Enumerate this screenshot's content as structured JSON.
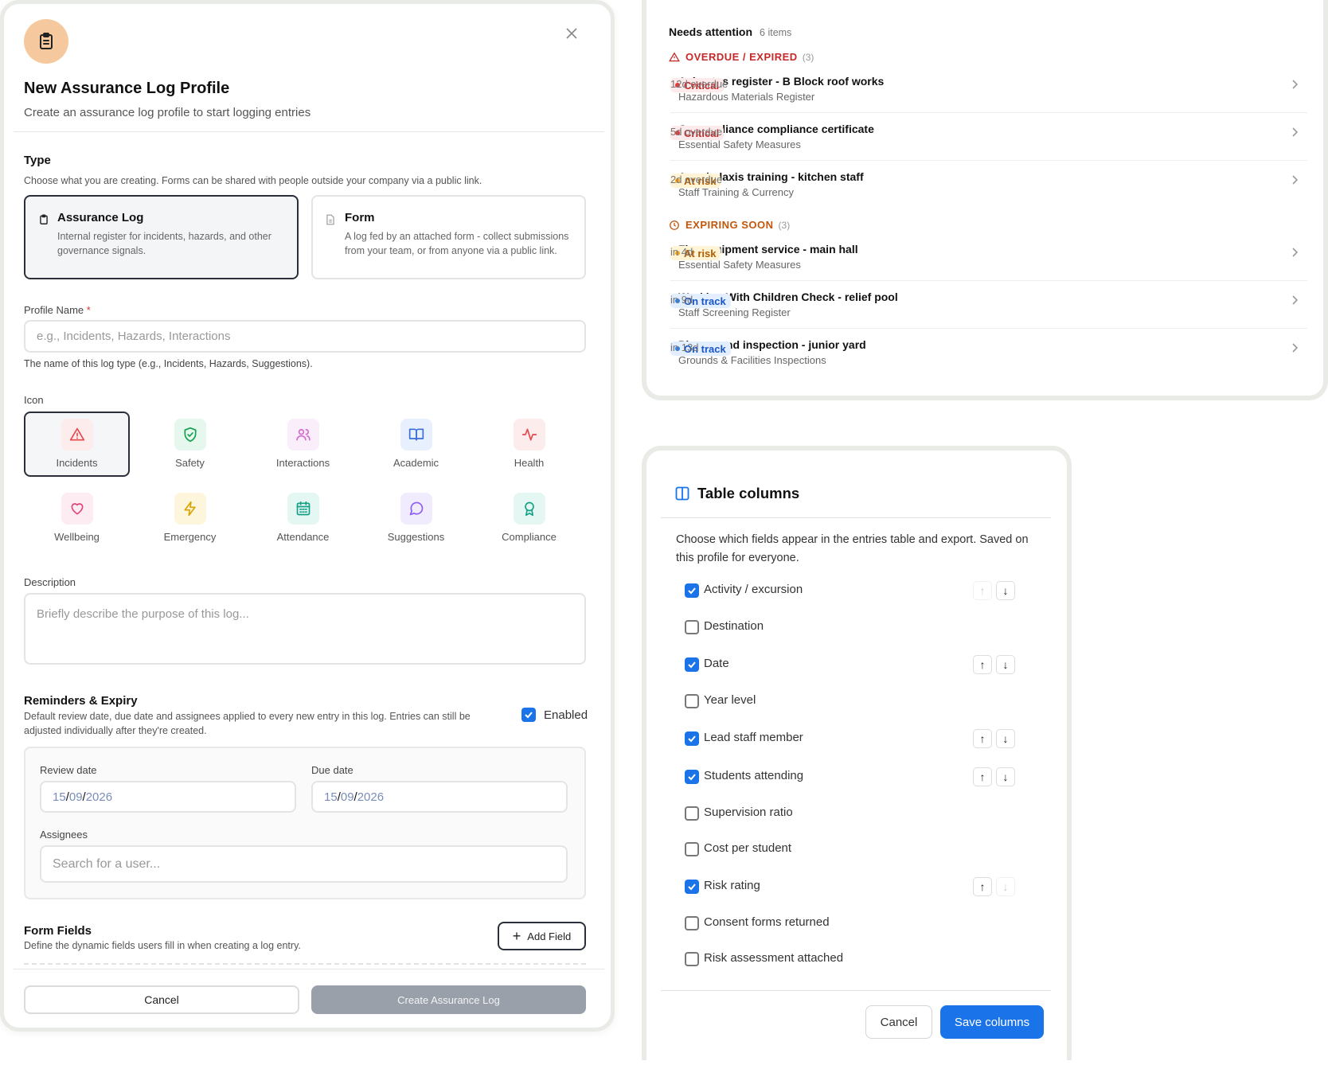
{
  "modal": {
    "title": "New Assurance Log Profile",
    "subtitle": "Create an assurance log profile to start logging entries",
    "type": {
      "heading": "Type",
      "description": "Choose what you are creating. Forms can be shared with people outside your company via a public link.",
      "options": [
        {
          "title": "Assurance Log",
          "description": "Internal register for incidents, hazards, and other governance signals.",
          "selected": true
        },
        {
          "title": "Form",
          "description": "A log fed by an attached form - collect submissions from your team, or from anyone via a public link.",
          "selected": false
        }
      ]
    },
    "profile_name": {
      "label": "Profile Name",
      "required_mark": "*",
      "placeholder": "e.g., Incidents, Hazards, Interactions",
      "help": "The name of this log type (e.g., Incidents, Hazards, Suggestions)."
    },
    "icon": {
      "label": "Icon",
      "options": [
        {
          "label": "Incidents",
          "icon": "alert-triangle-icon",
          "color": "#e5484d",
          "bg": "#fdecec",
          "selected": true
        },
        {
          "label": "Safety",
          "icon": "shield-check-icon",
          "color": "#12a150",
          "bg": "#e6f7ee"
        },
        {
          "label": "Interactions",
          "icon": "users-icon",
          "color": "#d46bd0",
          "bg": "#fbeefb"
        },
        {
          "label": "Academic",
          "icon": "book-open-icon",
          "color": "#3b6fd8",
          "bg": "#e8effd"
        },
        {
          "label": "Health",
          "icon": "activity-icon",
          "color": "#e5484d",
          "bg": "#fdecec"
        },
        {
          "label": "Wellbeing",
          "icon": "heart-icon",
          "color": "#e0467c",
          "bg": "#fdecf2"
        },
        {
          "label": "Emergency",
          "icon": "zap-icon",
          "color": "#d9a300",
          "bg": "#fdf6dc"
        },
        {
          "label": "Attendance",
          "icon": "calendar-icon",
          "color": "#12a186",
          "bg": "#e4f7f2"
        },
        {
          "label": "Suggestions",
          "icon": "message-circle-icon",
          "color": "#8b5cf6",
          "bg": "#f1ecfd"
        },
        {
          "label": "Compliance",
          "icon": "award-icon",
          "color": "#12a186",
          "bg": "#e4f7f2"
        }
      ]
    },
    "description": {
      "label": "Description",
      "placeholder": "Briefly describe the purpose of this log..."
    },
    "reminders": {
      "heading": "Reminders & Expiry",
      "description": "Default review date, due date and assignees applied to every new entry in this log. Entries can still be adjusted individually after they're created.",
      "enabled_label": "Enabled",
      "enabled": true,
      "review_label": "Review date",
      "review_value": {
        "d": "15",
        "m": "09",
        "y": "2026"
      },
      "due_label": "Due date",
      "due_value": {
        "d": "15",
        "m": "09",
        "y": "2026"
      },
      "assignees_label": "Assignees",
      "assignees_placeholder": "Search for a user..."
    },
    "form_fields": {
      "heading": "Form Fields",
      "description": "Define the dynamic fields users fill in when creating a log entry.",
      "add_label": "Add Field"
    },
    "footer": {
      "cancel": "Cancel",
      "create": "Create Assurance Log"
    }
  },
  "attention": {
    "title": "Needs attention",
    "count": "6 items",
    "groups": [
      {
        "label": "OVERDUE / EXPIRED",
        "count": "(3)",
        "color": "#c62828",
        "items": [
          {
            "title": "Asbestos register - B Block roof works",
            "sub": "Hazardous Materials Register",
            "badge": "Critical",
            "status": "crit",
            "due": "12d overdue"
          },
          {
            "title": "Gas appliance compliance certificate",
            "sub": "Essential Safety Measures",
            "badge": "Critical",
            "status": "crit",
            "due": "5d overdue"
          },
          {
            "title": "Anaphylaxis training - kitchen staff",
            "sub": "Staff Training & Currency",
            "badge": "At risk",
            "status": "risk",
            "due": "2d overdue"
          }
        ]
      },
      {
        "label": "EXPIRING SOON",
        "count": "(3)",
        "color": "#c2570c",
        "items": [
          {
            "title": "Fire equipment service - main hall",
            "sub": "Essential Safety Measures",
            "badge": "At risk",
            "status": "risk",
            "due": "in 4d"
          },
          {
            "title": "Working With Children Check - relief pool",
            "sub": "Staff Screening Register",
            "badge": "On track",
            "status": "ok",
            "due": "in 9d"
          },
          {
            "title": "Playground inspection - junior yard",
            "sub": "Grounds & Facilities Inspections",
            "badge": "On track",
            "status": "ok",
            "due": "in 13d"
          }
        ]
      }
    ]
  },
  "table_columns": {
    "title": "Table columns",
    "description": "Choose which fields appear in the entries table and export. Saved on this profile for everyone.",
    "columns": [
      {
        "label": "Activity / excursion",
        "checked": true,
        "up": false,
        "down": true
      },
      {
        "label": "Destination",
        "checked": false
      },
      {
        "label": "Date",
        "checked": true,
        "up": true,
        "down": true
      },
      {
        "label": "Year level",
        "checked": false
      },
      {
        "label": "Lead staff member",
        "checked": true,
        "up": true,
        "down": true
      },
      {
        "label": "Students attending",
        "checked": true,
        "up": true,
        "down": true
      },
      {
        "label": "Supervision ratio",
        "checked": false
      },
      {
        "label": "Cost per student",
        "checked": false
      },
      {
        "label": "Risk rating",
        "checked": true,
        "up": true,
        "down": false
      },
      {
        "label": "Consent forms returned",
        "checked": false
      },
      {
        "label": "Risk assessment attached",
        "checked": false
      }
    ],
    "cancel": "Cancel",
    "save": "Save columns",
    "up_glyph": "↑",
    "down_glyph": "↓"
  }
}
